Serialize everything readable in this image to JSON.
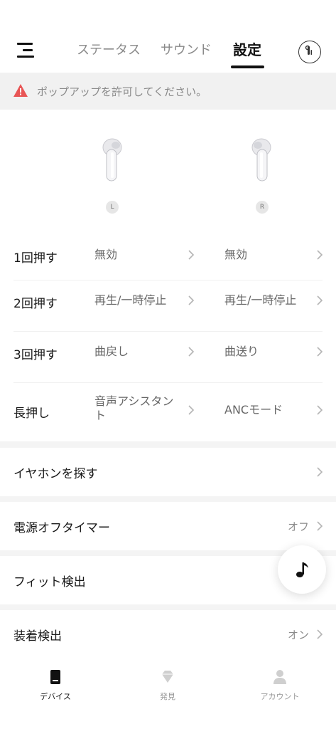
{
  "header": {
    "tabs": [
      {
        "label": "ステータス",
        "active": false
      },
      {
        "label": "サウンド",
        "active": false
      },
      {
        "label": "設定",
        "active": true
      }
    ]
  },
  "alert": {
    "message": "ポップアップを許可してください。",
    "icon": "warning-icon",
    "color": "#e85555"
  },
  "earbuds": {
    "left_badge": "L",
    "right_badge": "R"
  },
  "controls": [
    {
      "label": "1回押す",
      "left": "無効",
      "right": "無効"
    },
    {
      "label": "2回押す",
      "left": "再生/一時停止",
      "right": "再生/一時停止"
    },
    {
      "label": "3回押す",
      "left": "曲戻し",
      "right": "曲送り"
    },
    {
      "label": "長押し",
      "left_line1": "音声アシスタン",
      "left_line2": "ト",
      "right": "ANCモード"
    }
  ],
  "settings": [
    {
      "label": "イヤホンを探す",
      "value": ""
    },
    {
      "label": "電源オフタイマー",
      "value": "オフ"
    },
    {
      "label": "フィット検出",
      "value": ""
    },
    {
      "label": "装着検出",
      "value": "オン"
    }
  ],
  "fab": {
    "icon": "music-note-icon"
  },
  "bottom_nav": [
    {
      "label": "デバイス",
      "icon": "device-icon",
      "active": true
    },
    {
      "label": "発見",
      "icon": "diamond-icon",
      "active": false
    },
    {
      "label": "アカウント",
      "icon": "person-icon",
      "active": false
    }
  ]
}
